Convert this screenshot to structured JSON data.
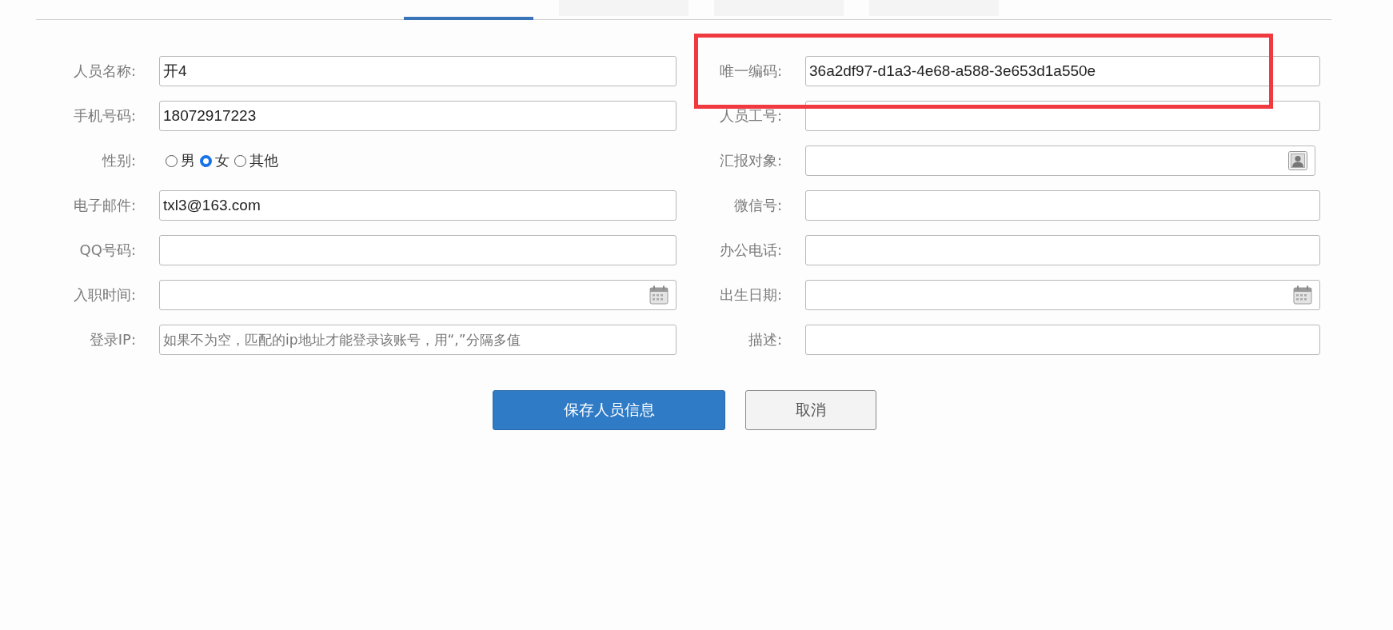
{
  "tabs": [
    {
      "selected": true
    },
    {
      "selected": false
    },
    {
      "selected": false
    },
    {
      "selected": false
    }
  ],
  "left_fields": [
    {
      "label": "人员名称:",
      "kind": "text",
      "value": "开4"
    },
    {
      "label": "手机号码:",
      "kind": "text",
      "value": "18072917223"
    },
    {
      "label": "性别:",
      "kind": "radio",
      "options": [
        {
          "label": "男",
          "selected": false
        },
        {
          "label": "女",
          "selected": true
        },
        {
          "label": "其他",
          "selected": false
        }
      ]
    },
    {
      "label": "电子邮件:",
      "kind": "text",
      "value": "txl3@163.com"
    },
    {
      "label": "QQ号码:",
      "kind": "text"
    },
    {
      "label": "入职时间:",
      "kind": "date"
    },
    {
      "label": "登录IP:",
      "kind": "text",
      "placeholder": "如果不为空，匹配的ip地址才能登录该账号，用“,”分隔多值"
    }
  ],
  "right_fields": [
    {
      "label": "唯一编码:",
      "kind": "text",
      "value": "36a2df97-d1a3-4e68-a588-3e653d1a550e",
      "highlighted": true
    },
    {
      "label": "人员工号:",
      "kind": "text",
      "highlighted": false
    },
    {
      "label": "汇报对象:",
      "kind": "person",
      "highlighted": false
    },
    {
      "label": "微信号:",
      "kind": "text",
      "highlighted": false
    },
    {
      "label": "办公电话:",
      "kind": "text",
      "highlighted": false
    },
    {
      "label": "出生日期:",
      "kind": "date",
      "highlighted": false
    },
    {
      "label": "描述:",
      "kind": "text",
      "highlighted": false
    }
  ],
  "buttons": [
    {
      "label": "保存人员信息",
      "kind": "primary"
    },
    {
      "label": "取消",
      "kind": "default"
    }
  ]
}
